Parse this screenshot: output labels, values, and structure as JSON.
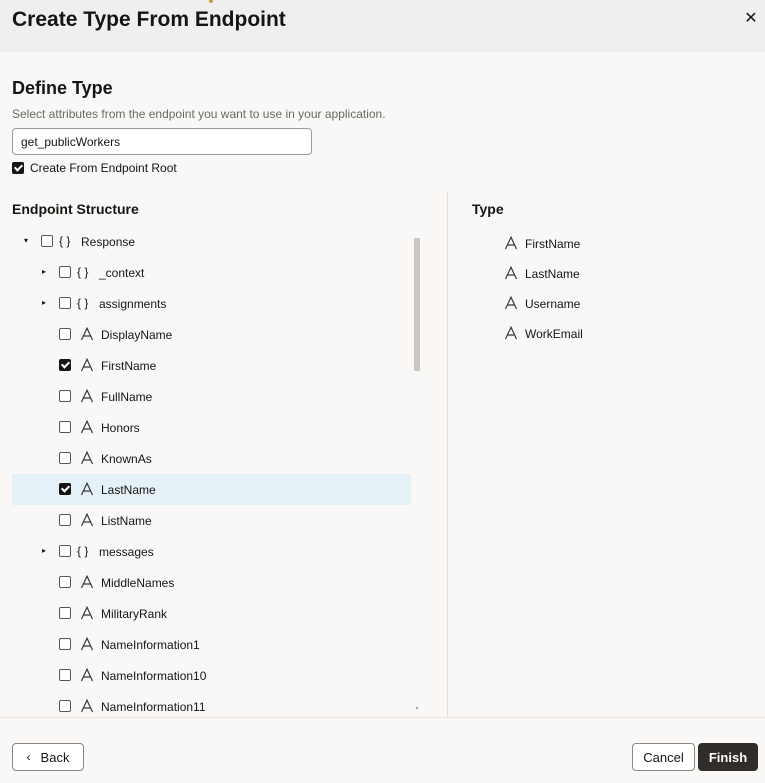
{
  "dialog": {
    "title": "Create Type From Endpoint",
    "close_icon": "close-icon"
  },
  "define": {
    "heading": "Define Type",
    "description": "Select attributes from the endpoint you want to use in your application.",
    "type_name_value": "get_publicWorkers",
    "root_checkbox_label": "Create From Endpoint Root",
    "root_checkbox_checked": true
  },
  "endpoint": {
    "heading": "Endpoint Structure",
    "rows": [
      {
        "label": "Response",
        "kind": "object",
        "expanded": true,
        "checked": false,
        "level": 0
      },
      {
        "label": "_context",
        "kind": "object",
        "expanded": false,
        "checked": false,
        "level": 1
      },
      {
        "label": "assignments",
        "kind": "object",
        "expanded": false,
        "checked": false,
        "level": 1
      },
      {
        "label": "DisplayName",
        "kind": "attribute",
        "checked": false,
        "level": 1
      },
      {
        "label": "FirstName",
        "kind": "attribute",
        "checked": true,
        "level": 1
      },
      {
        "label": "FullName",
        "kind": "attribute",
        "checked": false,
        "level": 1
      },
      {
        "label": "Honors",
        "kind": "attribute",
        "checked": false,
        "level": 1
      },
      {
        "label": "KnownAs",
        "kind": "attribute",
        "checked": false,
        "level": 1
      },
      {
        "label": "LastName",
        "kind": "attribute",
        "checked": true,
        "level": 1,
        "selected": true
      },
      {
        "label": "ListName",
        "kind": "attribute",
        "checked": false,
        "level": 1
      },
      {
        "label": "messages",
        "kind": "object",
        "expanded": false,
        "checked": false,
        "level": 1
      },
      {
        "label": "MiddleNames",
        "kind": "attribute",
        "checked": false,
        "level": 1
      },
      {
        "label": "MilitaryRank",
        "kind": "attribute",
        "checked": false,
        "level": 1
      },
      {
        "label": "NameInformation1",
        "kind": "attribute",
        "checked": false,
        "level": 1
      },
      {
        "label": "NameInformation10",
        "kind": "attribute",
        "checked": false,
        "level": 1
      },
      {
        "label": "NameInformation11",
        "kind": "attribute",
        "checked": false,
        "level": 1
      }
    ]
  },
  "type": {
    "heading": "Type",
    "items": [
      "FirstName",
      "LastName",
      "Username",
      "WorkEmail"
    ]
  },
  "footer": {
    "back_label": "Back",
    "cancel_label": "Cancel",
    "finish_label": "Finish"
  },
  "icons": {
    "object_glyph": "{ }",
    "attribute_glyph": "attribute-icon",
    "expand_glyph": "▸",
    "collapse_glyph": "▾"
  },
  "colors": {
    "finish_bg": "#312d2a",
    "selected_row_bg": "#e4f1f7",
    "header_bg": "#f1efed"
  }
}
